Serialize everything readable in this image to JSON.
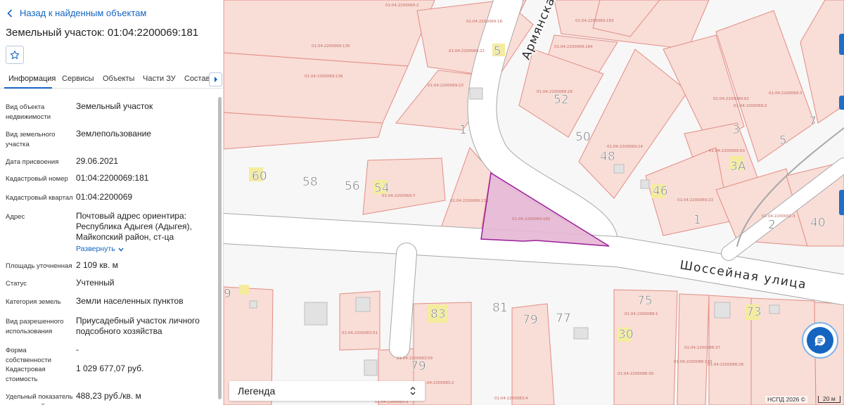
{
  "panel": {
    "back_label": "Назад к найденным объектам",
    "title": "Земельный участок: 01:04:2200069:181",
    "tabs": [
      "Информация",
      "Сервисы",
      "Объекты",
      "Части ЗУ",
      "Состав"
    ],
    "active_tab": "Информация",
    "rows": [
      {
        "label": "Вид объекта недвижимости",
        "value": "Земельный участок"
      },
      {
        "label": "Вид земельного участка",
        "value": "Землепользование"
      },
      {
        "label": "Дата присвоения",
        "value": "29.06.2021"
      },
      {
        "label": "Кадастровый номер",
        "value": "01:04:2200069:181"
      },
      {
        "label": "Кадастровый квартал",
        "value": "01:04:2200069"
      },
      {
        "label": "Адрес",
        "value": "Почтовый адрес ориентира: Республика Адыгея (Адыгея), Майкопский район, ст-ца Кужорская,"
      },
      {
        "label": "Площадь уточненная",
        "value": "2 109 кв. м"
      },
      {
        "label": "Статус",
        "value": "Учтенный"
      },
      {
        "label": "Категория земель",
        "value": "Земли населенных пунктов"
      },
      {
        "label": "Вид разрешенного использования",
        "value": "Приусадебный участок личного подсобного хозяйства"
      },
      {
        "label": "Форма собственности",
        "value": "-"
      },
      {
        "label": "Кадастровая стоимость",
        "value": "1 029 677,07 руб."
      },
      {
        "label": "Удельный показатель кадастровой",
        "value": "488,23 руб./кв. м"
      }
    ],
    "expand_label": "Развернуть"
  },
  "map": {
    "streets": [
      "Армянская",
      "Шоссейная улица"
    ],
    "house_numbers": [
      "60",
      "58",
      "56",
      "54",
      "52",
      "50",
      "48",
      "46",
      "5",
      "1",
      "3",
      "3А",
      "5",
      "7",
      "1",
      "2",
      "40",
      "75",
      "73",
      "83",
      "81",
      "79",
      "77",
      "30",
      "79",
      "9"
    ],
    "parcel_ids": [
      "01:04:2200069:2",
      "01:04:2200069:18",
      "01:04:2200069:183",
      "01:04:2200069:135",
      "01:04:2200069:22",
      "01:04:2200069:184",
      "01:04:2200069:136",
      "01:04:2200069:23",
      "01:04:2200069:16",
      "01:04:2200069:14",
      "01:04:2200069:62",
      "01:04:2200069:2",
      "01:04:2200069:3",
      "01:04:2200069:63",
      "01:04:2200069:7",
      "01:04:2200069:134",
      "01:04:2200069:181",
      "01:04:2200069:23",
      "01:04:2200001:3",
      "01:04:2200088:1",
      "01:04:2200083:51",
      "01:04:2200083:59",
      "01:04:2200083:2",
      "01:04:2200088:37",
      "01:04:2200088:110",
      "01:04:2200088:39",
      "01:04:2200088:28",
      "01:04:2200083:4",
      "01:04:2200083:3"
    ],
    "legend_label": "Легенда",
    "credit": "НСПД 2026 ©",
    "scale_label": "20 м",
    "colors": {
      "parcel_fill": "#f9ddd7",
      "parcel_stroke": "#e28d84",
      "selected_fill": "#e4b6d4",
      "selected_stroke": "#9b1f9a",
      "road_fill": "#ffffff",
      "road_stroke": "#a8a8a8",
      "number_fill": "#f4ec9c",
      "accent": "#1565c0"
    }
  }
}
